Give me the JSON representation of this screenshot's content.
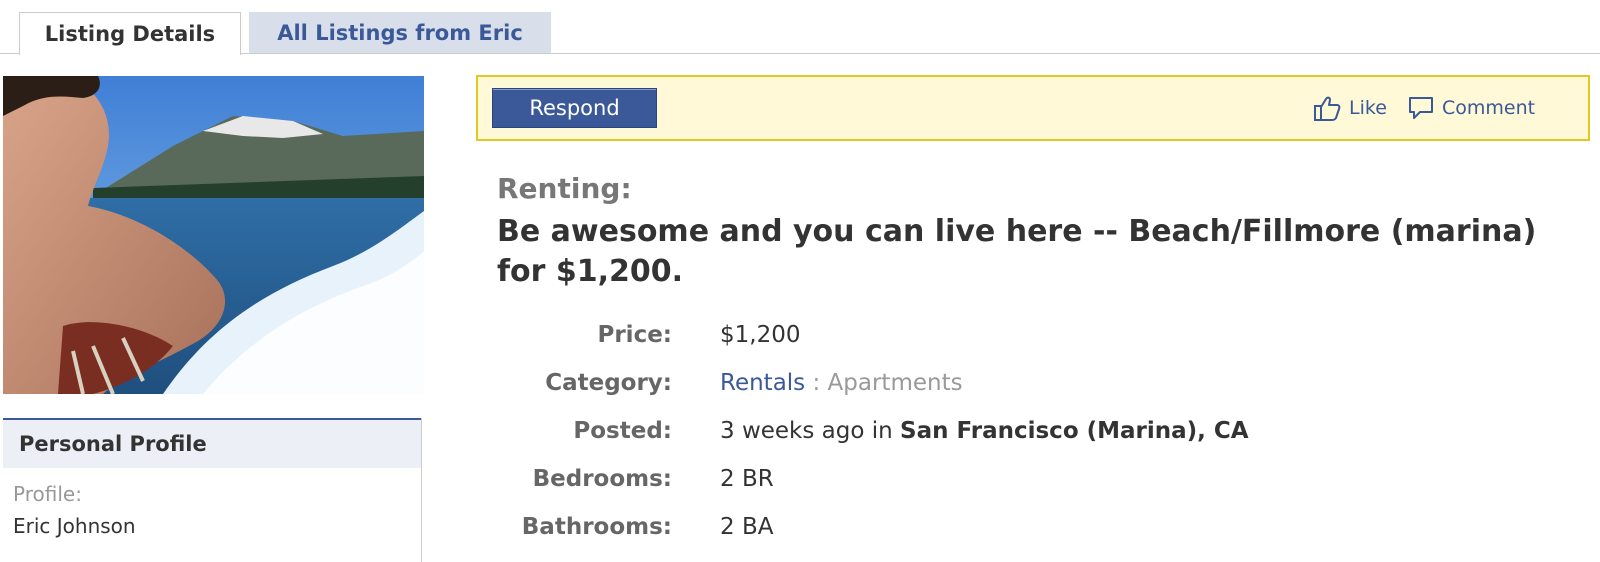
{
  "tabs": [
    {
      "label": "Listing Details",
      "active": true
    },
    {
      "label": "All Listings from Eric",
      "active": false
    }
  ],
  "profile": {
    "heading": "Personal Profile",
    "label": "Profile:",
    "name": "Eric Johnson"
  },
  "actions": {
    "respond_label": "Respond",
    "like_label": "Like",
    "like_icon": "thumbs-up-icon",
    "comment_label": "Comment",
    "comment_icon": "speech-bubble-icon"
  },
  "listing": {
    "type_label": "Renting:",
    "title": "Be awesome and you can live here -- Beach/Fillmore (marina) for $1,200."
  },
  "details": {
    "price_label": "Price:",
    "price_value": "$1,200",
    "category_label": "Category:",
    "category_link": "Rentals",
    "category_sep": " : ",
    "category_sub": "Apartments",
    "posted_label": "Posted:",
    "posted_prefix": "3 weeks ago in ",
    "posted_location": "San Francisco (Marina), CA",
    "bedrooms_label": "Bedrooms:",
    "bedrooms_value": "2 BR",
    "bathrooms_label": "Bathrooms:",
    "bathrooms_value": "2 BA"
  },
  "colors": {
    "brand": "#3b5998",
    "tab_inactive_bg": "#d8dfea",
    "action_bar_bg": "#fff9d7",
    "action_bar_border": "#e2c822"
  }
}
